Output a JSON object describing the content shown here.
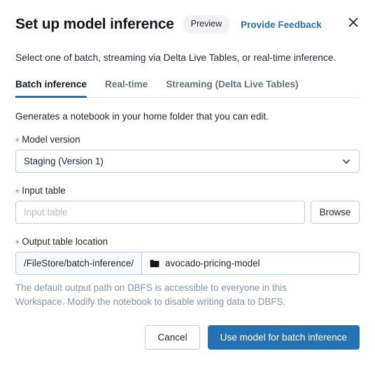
{
  "dialog": {
    "title": "Set up model inference",
    "badge": "Preview",
    "feedback_link": "Provide Feedback",
    "close_icon": "close-icon",
    "intro": "Select one of batch, streaming via Delta Live Tables, or real-time inference."
  },
  "tabs": [
    {
      "label": "Batch inference",
      "active": true
    },
    {
      "label": "Real-time",
      "active": false
    },
    {
      "label": "Streaming (Delta Live Tables)",
      "active": false
    }
  ],
  "batch": {
    "subnote": "Generates a notebook in your home folder that you can edit.",
    "model_version": {
      "label": "Model version",
      "required_mark": "*",
      "value": "Staging (Version 1)",
      "chevron_icon": "chevron-down-icon"
    },
    "input_table": {
      "label": "Input table",
      "required_mark": "*",
      "value": "",
      "placeholder": "Input table",
      "browse_label": "Browse"
    },
    "output_table": {
      "label": "Output table location",
      "required_mark": "*",
      "prefix": "/FileStore/batch-inference/",
      "folder_icon": "folder-icon",
      "value": "avocado-pricing-model"
    },
    "helper": "The default output path on DBFS is accessible to everyone in this Workspace. Modify the notebook to disable writing data to DBFS."
  },
  "footer": {
    "cancel_label": "Cancel",
    "submit_label": "Use model for batch inference"
  },
  "colors": {
    "primary": "#2272B4",
    "link": "#2272B4",
    "required": "#E65B77",
    "badge_bg": "#F2F2F3",
    "border": "#C0CDD8",
    "muted_text": "#8396A5"
  }
}
